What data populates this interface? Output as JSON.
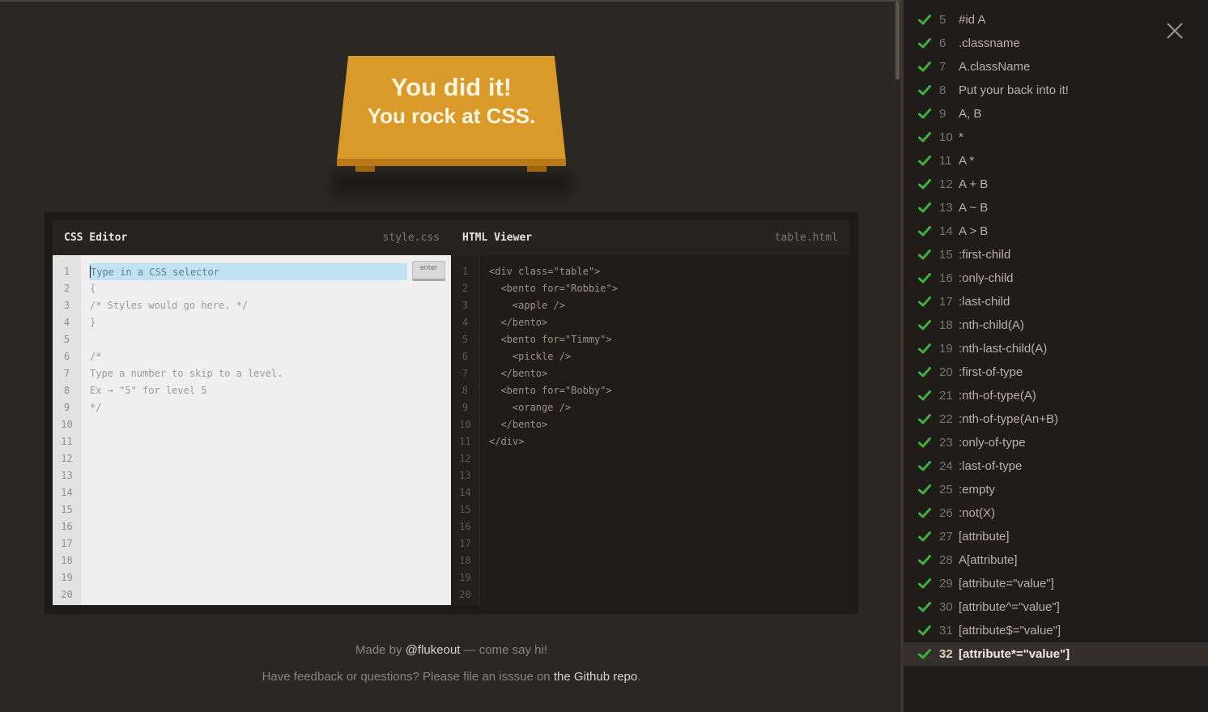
{
  "win": {
    "line1": "You did it!",
    "line2": "You rock at CSS."
  },
  "css_editor": {
    "title": "CSS Editor",
    "file": "style.css",
    "input_placeholder": "Type in a CSS selector",
    "enter_label": "enter",
    "lines": [
      "",
      "{",
      "/* Styles would go here. */",
      "}",
      "",
      "/*",
      "Type a number to skip to a level.",
      "Ex → \"5\" for level 5",
      "*/",
      "",
      "",
      "",
      "",
      "",
      "",
      "",
      "",
      "",
      "",
      ""
    ]
  },
  "html_viewer": {
    "title": "HTML Viewer",
    "file": "table.html",
    "lines": [
      "<div class=\"table\">",
      "  <bento for=\"Robbie\">",
      "    <apple />",
      "  </bento>",
      "  <bento for=\"Timmy\">",
      "    <pickle />",
      "  </bento>",
      "  <bento for=\"Bobby\">",
      "    <orange />",
      "  </bento>",
      "</div>",
      "",
      "",
      "",
      "",
      "",
      "",
      "",
      "",
      ""
    ]
  },
  "line_numbers": [
    "1",
    "2",
    "3",
    "4",
    "5",
    "6",
    "7",
    "8",
    "9",
    "10",
    "11",
    "12",
    "13",
    "14",
    "15",
    "16",
    "17",
    "18",
    "19",
    "20"
  ],
  "footer": {
    "made_by_prefix": "Made by ",
    "made_by_link": "@flukeout",
    "made_by_suffix": " — come say hi!",
    "feedback_prefix": "Have feedback or questions? Please file an isssue on ",
    "feedback_link": "the Github repo",
    "feedback_suffix": "."
  },
  "levels": [
    {
      "num": "5",
      "name": "#id A"
    },
    {
      "num": "6",
      "name": ".classname"
    },
    {
      "num": "7",
      "name": "A.className"
    },
    {
      "num": "8",
      "name": "Put your back into it!"
    },
    {
      "num": "9",
      "name": "A, B"
    },
    {
      "num": "10",
      "name": "*"
    },
    {
      "num": "11",
      "name": "A  *"
    },
    {
      "num": "12",
      "name": "A + B"
    },
    {
      "num": "13",
      "name": "A ~ B"
    },
    {
      "num": "14",
      "name": "A > B"
    },
    {
      "num": "15",
      "name": ":first-child"
    },
    {
      "num": "16",
      "name": ":only-child"
    },
    {
      "num": "17",
      "name": ":last-child"
    },
    {
      "num": "18",
      "name": ":nth-child(A)"
    },
    {
      "num": "19",
      "name": ":nth-last-child(A)"
    },
    {
      "num": "20",
      "name": ":first-of-type"
    },
    {
      "num": "21",
      "name": ":nth-of-type(A)"
    },
    {
      "num": "22",
      "name": ":nth-of-type(An+B)"
    },
    {
      "num": "23",
      "name": ":only-of-type"
    },
    {
      "num": "24",
      "name": ":last-of-type"
    },
    {
      "num": "25",
      "name": ":empty"
    },
    {
      "num": "26",
      "name": ":not(X)"
    },
    {
      "num": "27",
      "name": "[attribute]"
    },
    {
      "num": "28",
      "name": "A[attribute]"
    },
    {
      "num": "29",
      "name": "[attribute=\"value\"]"
    },
    {
      "num": "30",
      "name": "[attribute^=\"value\"]"
    },
    {
      "num": "31",
      "name": "[attribute$=\"value\"]"
    },
    {
      "num": "32",
      "name": "[attribute*=\"value\"]"
    }
  ],
  "current_level": "32",
  "icons": {
    "check": "check-icon",
    "close": "close-icon"
  },
  "colors": {
    "check": "#3fae3f",
    "table": "#da9a2a",
    "background": "#2b2722",
    "sidebar": "#1f1c1a"
  }
}
